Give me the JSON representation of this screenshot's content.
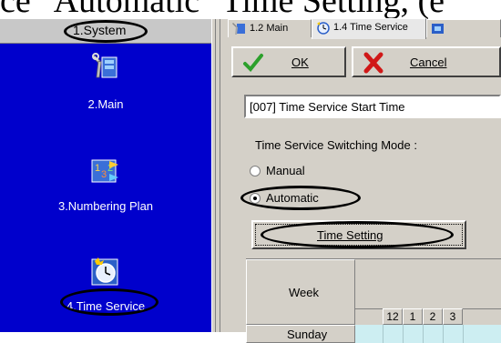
{
  "caption": {
    "text": "ce \"Automatic\" Time Setting, (e"
  },
  "sidebar": {
    "header": "1.System",
    "items": [
      {
        "label": "2.Main",
        "icon": "tools-icon"
      },
      {
        "label": "3.Numbering Plan",
        "icon": "numbering-icon"
      },
      {
        "label": "4.Time Service",
        "icon": "clock-icon"
      }
    ]
  },
  "tabs": [
    {
      "label": "1.2 Main",
      "icon": "main-tab-icon"
    },
    {
      "label": "1.4 Time Service",
      "icon": "time-tab-icon"
    },
    {
      "label": "",
      "icon": "extra-tab-icon"
    }
  ],
  "toolbar": {
    "ok_label": "OK",
    "cancel_label": "Cancel"
  },
  "setting_title": "[007] Time Service Start Time",
  "mode": {
    "label": "Time Service Switching Mode :",
    "options": [
      "Manual",
      "Automatic"
    ],
    "selected": "Automatic"
  },
  "time_setting_button": "Time Setting",
  "grid": {
    "week_header": "Week",
    "hours": [
      "12",
      "1",
      "2",
      "3"
    ],
    "days": [
      "Sunday"
    ]
  },
  "colors": {
    "sidebar_bg": "#0000cc",
    "panel_bg": "#d4d0c8",
    "grid_cell": "#cdeef2"
  }
}
